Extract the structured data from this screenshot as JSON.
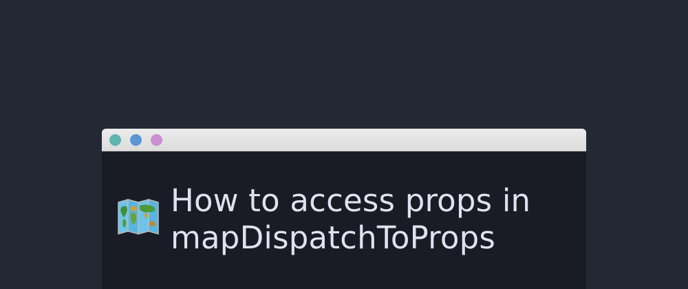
{
  "colors": {
    "background": "#222834",
    "window": "#1a1c25",
    "titlebar": "#e4e4e4",
    "title_text": "#dfe2f0",
    "dot_1": "#5fb5b0",
    "dot_2": "#5b97d2",
    "dot_3": "#c98fd1"
  },
  "window": {
    "controls": [
      {
        "name": "window-dot-teal",
        "color": "#5fb5b0"
      },
      {
        "name": "window-dot-blue",
        "color": "#5b97d2"
      },
      {
        "name": "window-dot-pink",
        "color": "#c98fd1"
      }
    ]
  },
  "article": {
    "icon": "world-map-icon",
    "title_line_1": "How to access props in",
    "title_line_2": "mapDispatchToProps"
  }
}
